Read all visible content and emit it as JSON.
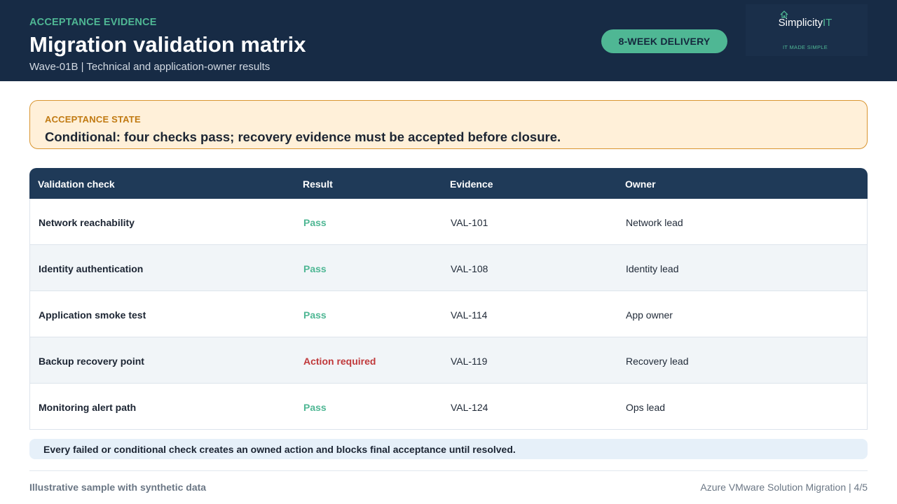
{
  "header": {
    "eyebrow": "ACCEPTANCE EVIDENCE",
    "title": "Migration validation matrix",
    "subtitle": "Wave-01B | Technical and application-owner results",
    "badge": "8-WEEK DELIVERY",
    "logo": {
      "name": "Simplicity",
      "name_accent": "IT",
      "tagline": "IT MADE SIMPLE",
      "icon": "cloud-house-icon"
    }
  },
  "acceptance_state": {
    "label": "ACCEPTANCE STATE",
    "text": "Conditional: four checks pass; recovery evidence must be accepted before closure."
  },
  "table": {
    "columns": [
      "Validation check",
      "Result",
      "Evidence",
      "Owner"
    ],
    "rows": [
      {
        "check": "Network reachability",
        "result": "Pass",
        "evidence": "VAL-101",
        "owner": "Network lead"
      },
      {
        "check": "Identity authentication",
        "result": "Pass",
        "evidence": "VAL-108",
        "owner": "Identity lead"
      },
      {
        "check": "Application smoke test",
        "result": "Pass",
        "evidence": "VAL-114",
        "owner": "App owner"
      },
      {
        "check": "Backup recovery point",
        "result": "Action required",
        "evidence": "VAL-119",
        "owner": "Recovery lead"
      },
      {
        "check": "Monitoring alert path",
        "result": "Pass",
        "evidence": "VAL-124",
        "owner": "Ops lead"
      }
    ]
  },
  "note": "Every failed or conditional check creates an owned action and blocks final acceptance until resolved.",
  "footer": {
    "left": "Illustrative sample with synthetic data",
    "right": "Azure VMware Solution Migration | 4/5"
  },
  "colors": {
    "navy": "#172b45",
    "table_header": "#1f3a58",
    "accent_green": "#4fb794",
    "warning_orange": "#c17a12",
    "warning_bg": "#fff0d9",
    "action_red": "#c0393b",
    "note_bg": "#e6f0f9"
  }
}
